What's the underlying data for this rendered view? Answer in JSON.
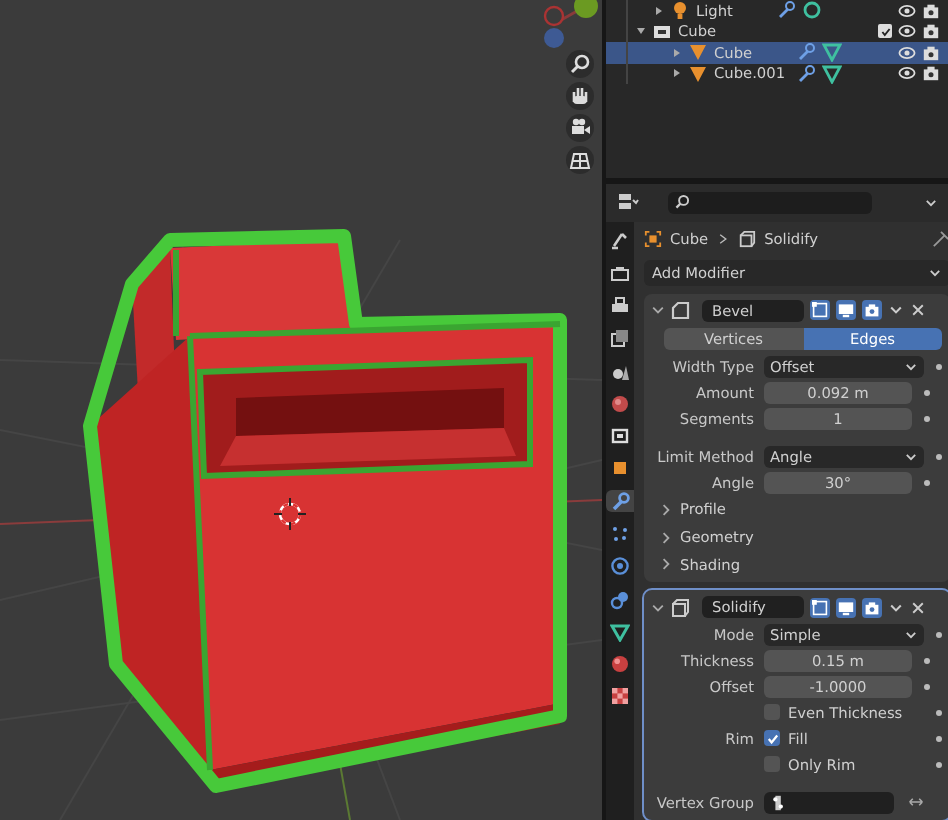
{
  "outliner": {
    "items": [
      {
        "kind": "light",
        "name": "Light",
        "selected": false
      },
      {
        "kind": "collection",
        "name": "Cube",
        "expanded": true,
        "checked": true,
        "children": [
          {
            "kind": "mesh",
            "name": "Cube",
            "selected": true
          },
          {
            "kind": "mesh",
            "name": "Cube.001",
            "selected": false
          }
        ]
      }
    ]
  },
  "properties": {
    "tabs": [
      {
        "kind": "tool",
        "selected": false
      },
      {
        "kind": "render",
        "selected": false
      },
      {
        "kind": "output",
        "selected": false
      },
      {
        "kind": "view_layer",
        "selected": false
      },
      {
        "kind": "scene",
        "selected": false
      },
      {
        "kind": "world",
        "selected": false
      },
      {
        "kind": "collection",
        "selected": false
      },
      {
        "kind": "object",
        "selected": false
      },
      {
        "kind": "modifier",
        "selected": true
      },
      {
        "kind": "particles",
        "selected": false
      },
      {
        "kind": "physics",
        "selected": false
      },
      {
        "kind": "constraints",
        "selected": false
      },
      {
        "kind": "data",
        "selected": false
      },
      {
        "kind": "material",
        "selected": false
      },
      {
        "kind": "texture",
        "selected": false
      }
    ],
    "breadcrumb": [
      "Cube",
      "Solidify"
    ],
    "add_modifier": "Add Modifier",
    "modifiers": [
      {
        "kind": "bevel",
        "name": "Bevel",
        "expanded": true,
        "edit_mode": true,
        "show_viewport": true,
        "show_render": true,
        "segmented": [
          {
            "label": "Vertices",
            "selected": false
          },
          {
            "label": "Edges",
            "selected": true
          }
        ],
        "rows": [
          {
            "kind": "dropdown",
            "label": "Width Type",
            "value": "Offset"
          },
          {
            "kind": "number",
            "label": "Amount",
            "value": "0.092 m"
          },
          {
            "kind": "number",
            "label": "Segments",
            "value": "1"
          },
          {
            "kind": "dropdown",
            "label": "Limit Method",
            "value": "Angle"
          },
          {
            "kind": "number",
            "label": "Angle",
            "value": "30°"
          },
          {
            "kind": "subpanel",
            "label": "Profile",
            "expanded": false
          },
          {
            "kind": "subpanel",
            "label": "Geometry",
            "expanded": false
          },
          {
            "kind": "subpanel",
            "label": "Shading",
            "expanded": false
          }
        ]
      },
      {
        "kind": "solidify",
        "name": "Solidify",
        "expanded": true,
        "edit_mode": true,
        "show_viewport": true,
        "show_render": true,
        "rows": [
          {
            "kind": "dropdown",
            "label": "Mode",
            "value": "Simple"
          },
          {
            "kind": "number",
            "label": "Thickness",
            "value": "0.15 m"
          },
          {
            "kind": "number",
            "label": "Offset",
            "value": "-1.0000"
          },
          {
            "kind": "checkbox",
            "text": "Even Thickness",
            "checked": false
          },
          {
            "kind": "checkbox",
            "label": "Rim",
            "text": "Fill",
            "checked": true
          },
          {
            "kind": "checkbox",
            "text": "Only Rim",
            "checked": false
          },
          {
            "kind": "vertex_group",
            "label": "Vertex Group"
          }
        ]
      }
    ]
  }
}
